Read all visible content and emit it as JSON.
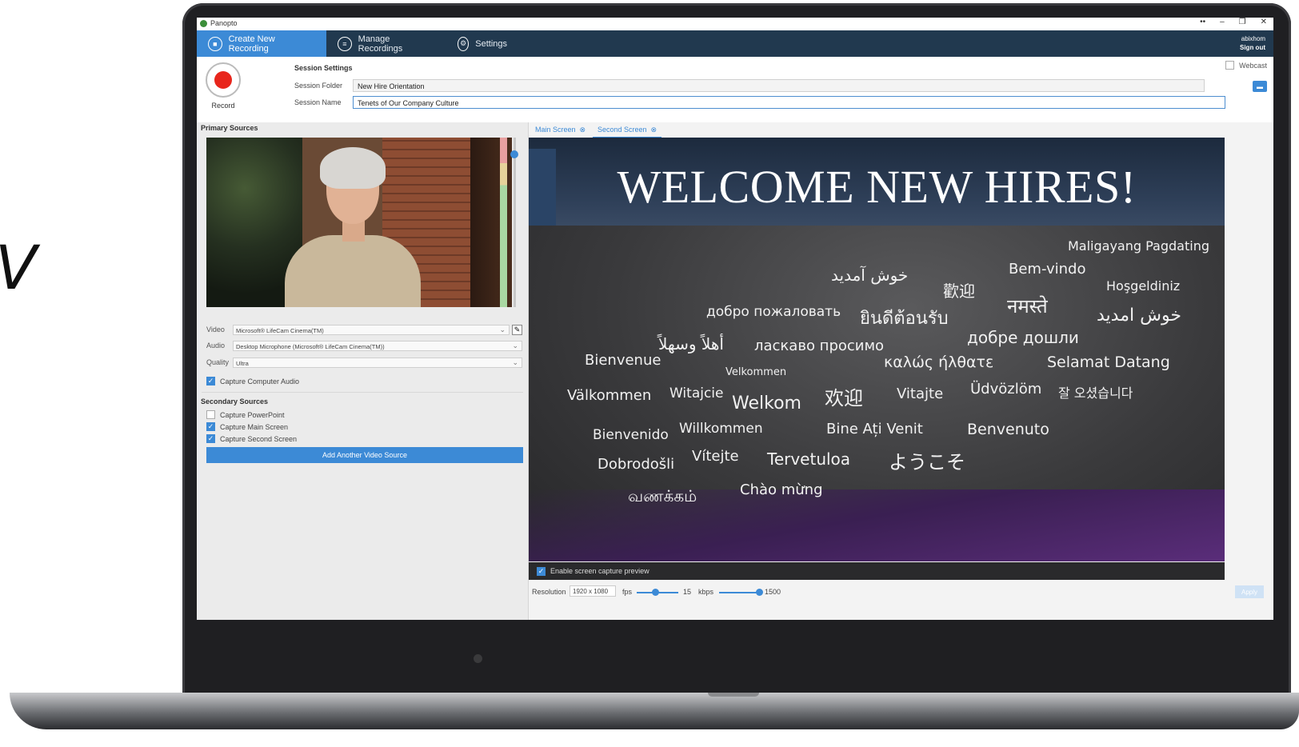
{
  "edge_glyph": "V",
  "window": {
    "app_title": "Panopto",
    "minimize": "–",
    "restore": "❐",
    "close": "✕",
    "pin": "••"
  },
  "nav": {
    "tabs": [
      {
        "label": "Create New Recording",
        "icon": "camera-icon"
      },
      {
        "label": "Manage Recordings",
        "icon": "list-icon"
      },
      {
        "label": "Settings",
        "icon": "gear-icon"
      }
    ],
    "user": "abixhom",
    "sign_out": "Sign out"
  },
  "session": {
    "record_label": "Record",
    "heading": "Session Settings",
    "folder_label": "Session Folder",
    "folder_value": "New Hire Orientation",
    "name_label": "Session Name",
    "name_value": "Tenets of Our Company Culture",
    "webcast_label": "Webcast",
    "webcast_checked": false
  },
  "primary": {
    "heading": "Primary Sources",
    "video_label": "Video",
    "video_value": "Microsoft® LifeCam Cinema(TM)",
    "audio_label": "Audio",
    "audio_value": "Desktop Microphone (Microsoft® LifeCam Cinema(TM))",
    "quality_label": "Quality",
    "quality_value": "Ultra",
    "capture_audio_label": "Capture Computer Audio",
    "capture_audio_checked": true
  },
  "secondary": {
    "heading": "Secondary Sources",
    "items": [
      {
        "label": "Capture PowerPoint",
        "checked": false
      },
      {
        "label": "Capture Main Screen",
        "checked": true
      },
      {
        "label": "Capture Second Screen",
        "checked": true
      }
    ],
    "add_button": "Add Another Video Source"
  },
  "preview": {
    "tabs": [
      {
        "label": "Main Screen",
        "active": false
      },
      {
        "label": "Second Screen",
        "active": true
      }
    ],
    "slide_title": "WELCOME NEW HIRES!",
    "words": [
      "Maligayang Pagdating",
      "خوش آمدید",
      "歡迎",
      "Bem-vindo",
      "Hoşgeldiniz",
      "добро пожаловать",
      "ยินดีต้อนรับ",
      "नमस्ते",
      "خوش امدید",
      "أهلاً وسهلاً",
      "ласкаво просимо",
      "добре дошли",
      "Bienvenue",
      "καλώς ήλθατε",
      "Selamat Datang",
      "Velkommen",
      "Välkommen",
      "Witajcie",
      "Welkom",
      "欢迎",
      "Vitajte",
      "Üdvözlöm",
      "잘 오셨습니다",
      "Bienvenido",
      "Willkommen",
      "Bine Ați Venit",
      "Benvenuto",
      "Dobrodošli",
      "Vítejte",
      "Tervetuloa",
      "ようこそ",
      "வணக்கம்",
      "Chào mừng"
    ],
    "enable_preview_label": "Enable screen capture preview",
    "enable_preview_checked": true,
    "resolution_label": "Resolution",
    "resolution_value": "1920 x 1080",
    "fps_label": "fps",
    "fps_value": "15",
    "fps_fraction": 0.45,
    "kbps_label": "kbps",
    "kbps_value": "1500",
    "kbps_fraction": 1.0,
    "apply_label": "Apply"
  },
  "colors": {
    "accent": "#3c8ad6",
    "navbar": "#21394f",
    "record": "#e8261c"
  }
}
